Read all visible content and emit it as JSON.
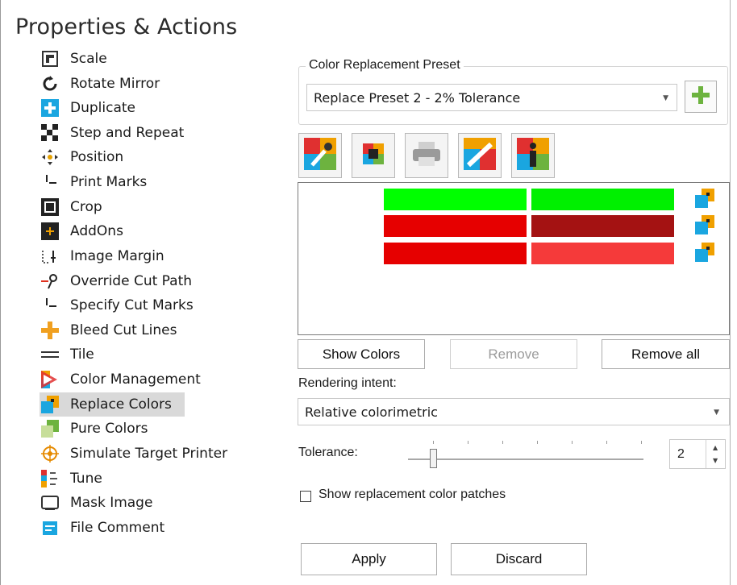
{
  "title": "Properties & Actions",
  "sidebar": {
    "items": [
      {
        "label": "Scale",
        "icon": "scale-icon"
      },
      {
        "label": "Rotate Mirror",
        "icon": "rotate-icon"
      },
      {
        "label": "Duplicate",
        "icon": "duplicate-icon"
      },
      {
        "label": "Step and Repeat",
        "icon": "step-repeat-icon"
      },
      {
        "label": "Position",
        "icon": "position-icon"
      },
      {
        "label": "Print Marks",
        "icon": "print-marks-icon"
      },
      {
        "label": "Crop",
        "icon": "crop-icon"
      },
      {
        "label": "AddOns",
        "icon": "addons-icon"
      },
      {
        "label": "Image Margin",
        "icon": "image-margin-icon"
      },
      {
        "label": "Override Cut Path",
        "icon": "cut-path-icon"
      },
      {
        "label": "Specify Cut Marks",
        "icon": "cut-marks-icon"
      },
      {
        "label": "Bleed Cut Lines",
        "icon": "bleed-icon"
      },
      {
        "label": "Tile",
        "icon": "tile-icon"
      },
      {
        "label": "Color Management",
        "icon": "color-management-icon"
      },
      {
        "label": "Replace Colors",
        "icon": "replace-colors-icon",
        "selected": true
      },
      {
        "label": "Pure Colors",
        "icon": "pure-colors-icon"
      },
      {
        "label": "Simulate Target Printer",
        "icon": "simulate-printer-icon"
      },
      {
        "label": "Tune",
        "icon": "tune-icon"
      },
      {
        "label": "Mask Image",
        "icon": "mask-image-icon"
      },
      {
        "label": "File Comment",
        "icon": "file-comment-icon"
      }
    ]
  },
  "preset": {
    "group_label": "Color Replacement Preset",
    "selected": "Replace Preset 2 - 2% Tolerance"
  },
  "toolbar": {
    "buttons": [
      "eyedropper-icon",
      "color-patches-icon",
      "printer-icon",
      "measure-icon",
      "info-icon"
    ]
  },
  "colors": {
    "rows": [
      {
        "original": "#00ff00",
        "replacement": "#00f000"
      },
      {
        "original": "#e60000",
        "replacement": "#a41212"
      },
      {
        "original": "#e60000",
        "replacement": "#f53a3a"
      }
    ]
  },
  "buttons": {
    "show_colors": "Show Colors",
    "remove": "Remove",
    "remove_all": "Remove all",
    "apply": "Apply",
    "discard": "Discard"
  },
  "rendering": {
    "label": "Rendering intent:",
    "selected": "Relative colorimetric"
  },
  "tolerance": {
    "label": "Tolerance:",
    "value": "2"
  },
  "show_patches": {
    "label": "Show replacement color patches",
    "checked": false
  }
}
